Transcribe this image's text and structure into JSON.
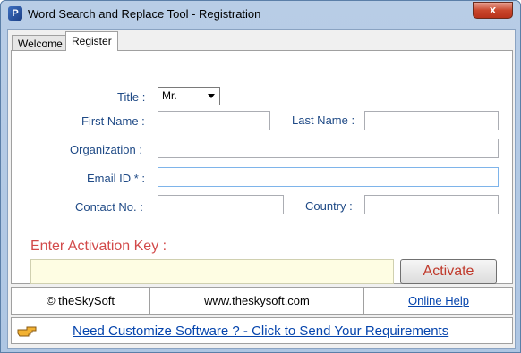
{
  "window": {
    "title": "Word Search and Replace Tool - Registration",
    "close_label": "x",
    "app_icon": "P"
  },
  "tabs": [
    {
      "label": "Welcome"
    },
    {
      "label": "Register"
    }
  ],
  "form": {
    "title_label": "Title :",
    "title_value": "Mr.",
    "first_name_label": "First Name :",
    "first_name_value": "",
    "last_name_label": "Last Name :",
    "last_name_value": "",
    "organization_label": "Organization :",
    "organization_value": "",
    "email_label": "Email ID * :",
    "email_value": "",
    "contact_label": "Contact No. :",
    "contact_value": "",
    "country_label": "Country :",
    "country_value": ""
  },
  "activation": {
    "label": "Enter Activation Key  :",
    "value": "",
    "button": "Activate"
  },
  "footer": {
    "copyright": "© theSkySoft",
    "website": "www.theskysoft.com",
    "help": "Online Help"
  },
  "banner": {
    "link": "Need Customize Software ? - Click to Send Your Requirements",
    "icon": "pointing-hand"
  },
  "colors": {
    "accent_red": "#d24a4a",
    "link_blue": "#0645ad",
    "label_blue": "#1f4a86",
    "key_field_bg": "#fefde3"
  }
}
